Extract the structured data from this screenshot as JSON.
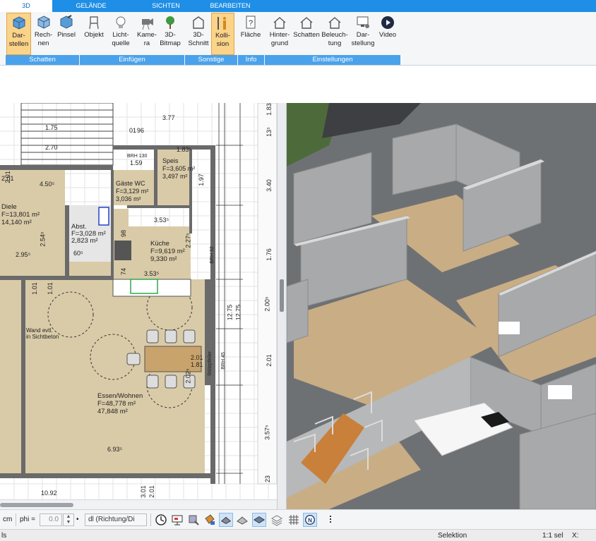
{
  "tabs": [
    {
      "label": "3D",
      "active": true
    },
    {
      "label": "GELÄNDE",
      "active": false
    },
    {
      "label": "SICHTEN",
      "active": false
    },
    {
      "label": "BEARBEITEN",
      "active": false
    }
  ],
  "ribbon": {
    "buttons": [
      {
        "label": "Dar-\nstellen",
        "icon": "cube-solid-icon"
      },
      {
        "label": "Rech-\nnen",
        "icon": "cube-render-icon"
      },
      {
        "label": "Pinsel",
        "icon": "cube-brush-icon"
      },
      {
        "label": "Objekt",
        "icon": "chair-icon"
      },
      {
        "label": "Licht-\nquelle",
        "icon": "lightbulb-icon"
      },
      {
        "label": "Kame-\nra",
        "icon": "camera-icon"
      },
      {
        "label": "3D-\nBitmap",
        "icon": "tree-icon"
      },
      {
        "label": "3D-\nSchnitt",
        "icon": "section-cut-icon"
      },
      {
        "label": "Kolli-\nsion",
        "icon": "person-collision-icon"
      },
      {
        "label": "Fläche",
        "icon": "area-info-icon"
      },
      {
        "label": "Hinter-\ngrund",
        "icon": "house-background-icon"
      },
      {
        "label": "Schatten",
        "icon": "house-shadow-icon"
      },
      {
        "label": "Beleuch-\ntung",
        "icon": "house-lighting-icon"
      },
      {
        "label": "Dar-\nstellung",
        "icon": "monitor-settings-icon"
      },
      {
        "label": "Video",
        "icon": "play-video-icon"
      }
    ],
    "groups": [
      {
        "label": "Schatten"
      },
      {
        "label": "Einfügen"
      },
      {
        "label": "Sonstige"
      },
      {
        "label": "Info"
      },
      {
        "label": "Einstellungen"
      }
    ]
  },
  "plan": {
    "dimensions_top": [
      "3.77",
      "1.83⁵",
      "01",
      "96",
      "1.75",
      "2.70",
      "2.01"
    ],
    "dimensions_right": [
      "1.83",
      "3.40",
      "1.76",
      "2.00⁵",
      "2.01",
      "3.57⁵",
      "23",
      "13⁵",
      "12.75",
      "12.75"
    ],
    "dimensions_bottom": [
      "10.92",
      "6.93⁵",
      "3.01",
      "2.01"
    ],
    "rooms": [
      {
        "name": "Diele",
        "area1": "F=13,801 m²",
        "area2": "14,140 m²"
      },
      {
        "name": "Abst.",
        "area1": "F=3,028 m²",
        "area2": "2,823 m²"
      },
      {
        "name": "Küche",
        "area1": "F=9,619 m²",
        "area2": "9,330 m²"
      },
      {
        "name": "Speis",
        "area1": "F=3,605 m²",
        "area2": "3,497 m²"
      },
      {
        "name": "Gäste WC",
        "area1": "F=3,129 m²",
        "area2": "3,036 m²"
      },
      {
        "name": "Essen/Wohnen",
        "area1": "F=48,778 m²",
        "area2": "47,848 m²"
      }
    ],
    "labels": [
      "4.50⁵",
      "2.95⁵",
      "2.54⁵",
      "2.01",
      "1.01",
      "1.01",
      "3.53⁵",
      "3.53⁵",
      "74",
      "98",
      "60⁵",
      "2.27⁵",
      "2.01",
      "1.81",
      "2.02⁵",
      "1.97",
      "BRH 130",
      "1.59",
      "BRH 45",
      "BRH 92",
      "Stützpfeiler",
      "Wand evtl.\nin Sichtbeton"
    ]
  },
  "toolbar": {
    "unit": "cm",
    "phi_label": "phi =",
    "phi_value": "0.0",
    "direction_value": "dl (Richtung/Di",
    "icons": [
      "clock-icon",
      "presentation-icon",
      "brush-tool-icon",
      "paint-bucket-icon",
      "wall-tool-icon",
      "hatch-tool-icon",
      "layer-tool-icon",
      "stack-tool-icon",
      "grid-icon",
      "north-icon",
      "pin-icon"
    ]
  },
  "status": {
    "left": "ls",
    "mode": "Selektion",
    "scale": "1:1 sel",
    "coord_label": "X:"
  }
}
